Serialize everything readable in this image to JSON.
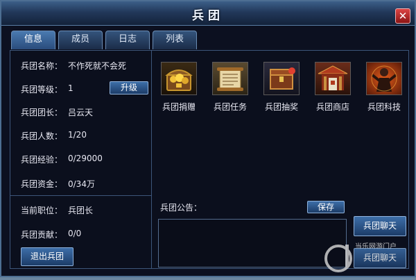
{
  "window": {
    "title": "兵团"
  },
  "tabs": [
    {
      "label": "信息",
      "active": true
    },
    {
      "label": "成员",
      "active": false
    },
    {
      "label": "日志",
      "active": false
    },
    {
      "label": "列表",
      "active": false
    }
  ],
  "info": {
    "name_label": "兵团名称：",
    "name_value": "不作死就不会死",
    "level_label": "兵团等级：",
    "level_value": "1",
    "leader_label": "兵团团长：",
    "leader_value": "吕云天",
    "members_label": "兵团人数：",
    "members_value": "1/20",
    "exp_label": "兵团经验：",
    "exp_value": "0/29000",
    "funds_label": "兵团资金：",
    "funds_value": "0/34万",
    "upgrade_button": "升级"
  },
  "member": {
    "position_label": "当前职位：",
    "position_value": "兵团长",
    "contribution_label": "兵团贡献：",
    "contribution_value": "0/0",
    "quit_button": "退出兵团"
  },
  "features": [
    {
      "label": "兵团捐赠",
      "icon": "treasure-chest-icon"
    },
    {
      "label": "兵团任务",
      "icon": "scroll-icon"
    },
    {
      "label": "兵团抽奖",
      "icon": "lottery-chest-icon"
    },
    {
      "label": "兵团商店",
      "icon": "shop-building-icon"
    },
    {
      "label": "兵团科技",
      "icon": "tech-figure-icon"
    }
  ],
  "notice": {
    "label": "兵团公告：",
    "save_button": "保存"
  },
  "chat": {
    "button": "兵团聊天",
    "button2": "兵团聊天"
  },
  "watermark": {
    "text": "当乐网游门户"
  },
  "colors": {
    "accent_blue": "#2a4c7c",
    "close_red": "#c62828",
    "panel_bg": "#0b0f1d"
  }
}
